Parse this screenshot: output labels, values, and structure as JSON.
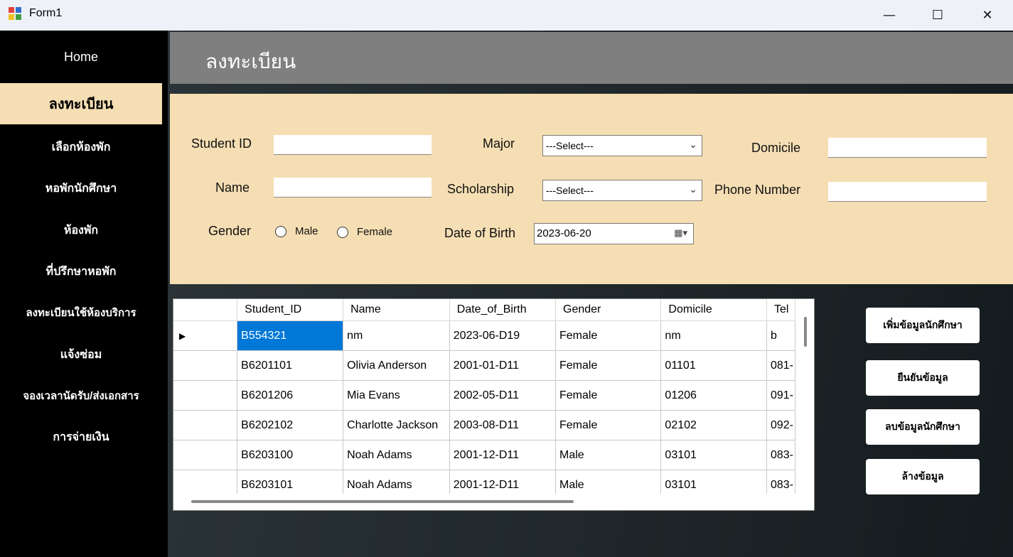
{
  "window": {
    "title": "Form1",
    "minimize": "—",
    "maximize": "☐",
    "close": "✕"
  },
  "sidebar": {
    "items": [
      {
        "label": "Home"
      },
      {
        "label": "ลงทะเบียน"
      },
      {
        "label": "เลือกห้องพัก"
      },
      {
        "label": "หอพักนักศึกษา"
      },
      {
        "label": "ห้องพัก"
      },
      {
        "label": "ที่ปรึกษาหอพัก"
      },
      {
        "label": "ลงทะเบียนใช้ห้องบริการ"
      },
      {
        "label": "แจ้งซ่อม"
      },
      {
        "label": "จองเวลานัดรับ/ส่งเอกสาร"
      },
      {
        "label": "การจ่ายเงิน"
      }
    ]
  },
  "header": {
    "title": "ลงทะเบียน"
  },
  "form": {
    "student_id_label": "Student ID",
    "name_label": "Name",
    "gender_label": "Gender",
    "male_label": "Male",
    "female_label": "Female",
    "major_label": "Major",
    "major_value": "---Select---",
    "scholarship_label": "Scholarship",
    "scholarship_value": "---Select---",
    "dob_label": "Date of Birth",
    "dob_value": "2023-06-20",
    "domicile_label": "Domicile",
    "phone_label": "Phone Number"
  },
  "grid": {
    "columns": [
      "Student_ID",
      "Name",
      "Date_of_Birth",
      "Gender",
      "Domicile",
      "Tel"
    ],
    "rows": [
      [
        "B554321",
        "nm",
        "2023-06-D19",
        "Female",
        "nm",
        "b"
      ],
      [
        "B6201101",
        "Olivia Anderson",
        "2001-01-D11",
        "Female",
        "01101",
        "081-"
      ],
      [
        "B6201206",
        "Mia Evans",
        "2002-05-D11",
        "Female",
        "01206",
        "091-"
      ],
      [
        "B6202102",
        "Charlotte Jackson",
        "2003-08-D11",
        "Female",
        "02102",
        "092-"
      ],
      [
        "B6203100",
        "Noah Adams",
        "2001-12-D11",
        "Male",
        "03101",
        "083-"
      ],
      [
        "B6203101",
        "Noah Adams",
        "2001-12-D11",
        "Male",
        "03101",
        "083-"
      ]
    ]
  },
  "actions": {
    "add": "เพิ่มข้อมูลนักศึกษา",
    "confirm": "ยืนยันข้อมูล",
    "delete": "ลบข้อมูลนักศึกษา",
    "clear": "ล้างข้อมูล"
  }
}
